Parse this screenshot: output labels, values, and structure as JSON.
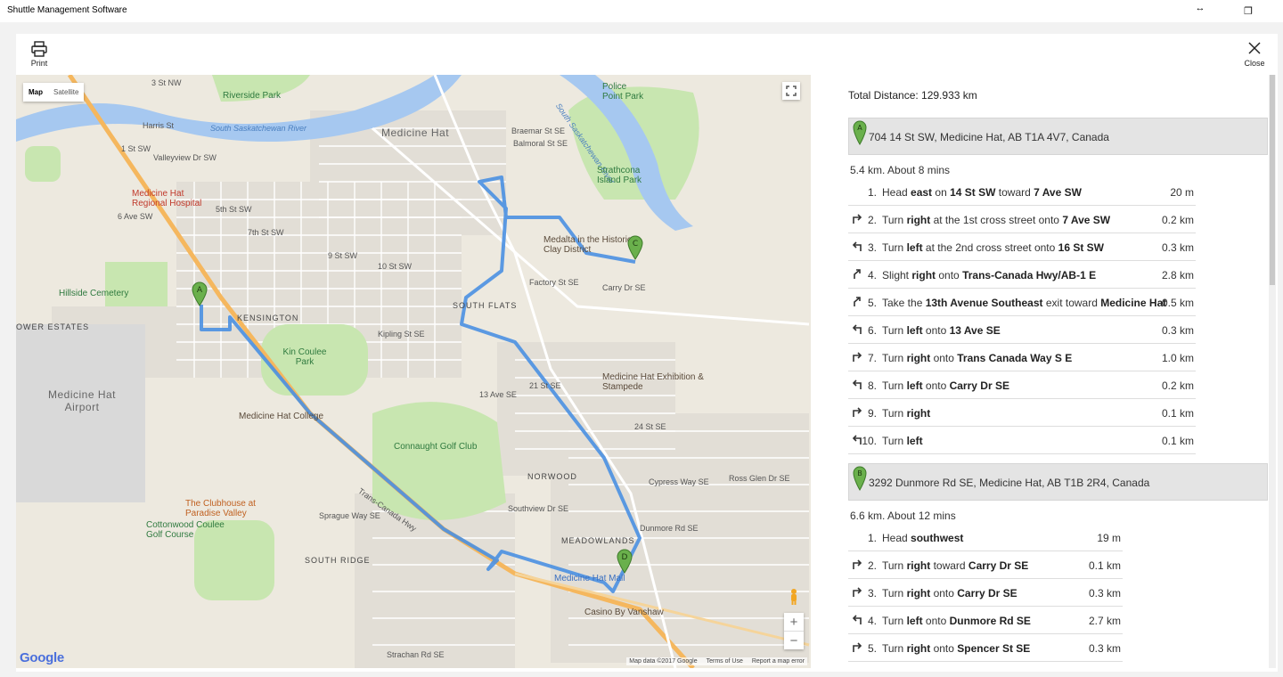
{
  "window": {
    "title": "Shuttle Management Software",
    "minimize_glyph": "↔",
    "restore_glyph": "❐"
  },
  "toolbar": {
    "print_label": "Print",
    "close_label": "Close"
  },
  "map": {
    "type_active": "Map",
    "type_other": "Satellite",
    "zoom_in": "+",
    "zoom_out": "−",
    "logo": "Google",
    "attribution": [
      "Map data ©2017 Google",
      "Terms of Use",
      "Report a map error"
    ],
    "markers": [
      "A",
      "B",
      "C",
      "D"
    ],
    "labels": {
      "medicine_hat": "Medicine Hat",
      "riverside_park": "Riverside Park",
      "river": "South Saskatchewan River",
      "river2": "South Saskatchewan River",
      "police_point": "Police Point Park",
      "strathcona": "Strathcona Island Park",
      "hospital": "Medicine Hat Regional Hospital",
      "medalta": "Medalta in the Historic Clay District",
      "hillside": "Hillside Cemetery",
      "kensington": "KENSINGTON",
      "south_flats": "SOUTH FLATS",
      "estates": "OWER ESTATES",
      "airport": "Medicine Hat Airport",
      "kin_coulee": "Kin Coulee Park",
      "exhibition": "Medicine Hat Exhibition & Stampede",
      "college": "Medicine Hat College",
      "connaught": "Connaught Golf Club",
      "norwood": "NORWOOD",
      "meadowlands": "MEADOWLANDS",
      "clubhouse": "The Clubhouse at Paradise Valley",
      "cottonwood": "Cottonwood Coulee Golf Course",
      "south_ridge": "SOUTH RIDGE",
      "mall": "Medicine Hat Mall",
      "casino": "Casino By Vanshaw",
      "trans_canada": "Trans-Canada Hwy",
      "st_3nw": "3 St NW",
      "st_1sw": "1 St SW",
      "harris": "Harris St",
      "valleyview": "Valleyview Dr SW",
      "ave_6sw": "6 Ave SW",
      "fifth_sw": "5th St SW",
      "seventh_sw": "7th St SW",
      "ninth_sw": "9 St SW",
      "ten_sw": "10 St SW",
      "carry": "Carry Dr SE",
      "factory": "Factory St SE",
      "kipling": "Kipling St SE",
      "braemar": "Braemar St SE",
      "balmoral": "Balmoral St SE",
      "cypress": "Cypress Way SE",
      "southview": "Southview Dr SE",
      "sprague": "Sprague Way SE",
      "strachan": "Strachan Rd SE",
      "ross_glen": "Ross Glen Dr SE",
      "dunmore": "Dunmore Rd SE",
      "ave_13se": "13 Ave SE",
      "twentyfour": "24 St SE",
      "twentyone": "21 St SE"
    }
  },
  "directions": {
    "total_distance": "Total Distance: 129.933 km",
    "legs": [
      {
        "marker": "A",
        "address": "704 14 St SW, Medicine Hat, AB T1A 4V7, Canada",
        "summary": "5.4 km. About 8 mins",
        "steps": [
          {
            "num": "1.",
            "icon": "none",
            "pre": "Head ",
            "b1": "east",
            "mid": " on ",
            "b2": "14 St SW",
            "post": " toward ",
            "b3": "7 Ave SW",
            "dist": "20 m"
          },
          {
            "num": "2.",
            "icon": "turn-right-icon",
            "pre": "Turn ",
            "b1": "right",
            "mid": " at the 1st cross street onto ",
            "b2": "7 Ave SW",
            "post": "",
            "b3": "",
            "dist": "0.2 km"
          },
          {
            "num": "3.",
            "icon": "turn-left-icon",
            "pre": "Turn ",
            "b1": "left",
            "mid": " at the 2nd cross street onto ",
            "b2": "16 St SW",
            "post": "",
            "b3": "",
            "dist": "0.3 km"
          },
          {
            "num": "4.",
            "icon": "slight-right-icon",
            "pre": "Slight ",
            "b1": "right",
            "mid": " onto ",
            "b2": "Trans-Canada Hwy/AB-1 E",
            "post": "",
            "b3": "",
            "dist": "2.8 km"
          },
          {
            "num": "5.",
            "icon": "slight-right-icon",
            "pre": "Take the ",
            "b1": "13th Avenue Southeast",
            "mid": " exit toward ",
            "b2": "Medicine Hat",
            "post": "",
            "b3": "",
            "dist": "0.5 km"
          },
          {
            "num": "6.",
            "icon": "turn-left-icon",
            "pre": "Turn ",
            "b1": "left",
            "mid": " onto ",
            "b2": "13 Ave SE",
            "post": "",
            "b3": "",
            "dist": "0.3 km"
          },
          {
            "num": "7.",
            "icon": "turn-right-icon",
            "pre": "Turn ",
            "b1": "right",
            "mid": " onto ",
            "b2": "Trans Canada Way S E",
            "post": "",
            "b3": "",
            "dist": "1.0 km"
          },
          {
            "num": "8.",
            "icon": "turn-left-icon",
            "pre": "Turn ",
            "b1": "left",
            "mid": " onto ",
            "b2": "Carry Dr SE",
            "post": "",
            "b3": "",
            "dist": "0.2 km"
          },
          {
            "num": "9.",
            "icon": "turn-right-icon",
            "pre": "Turn ",
            "b1": "right",
            "mid": "",
            "b2": "",
            "post": "",
            "b3": "",
            "dist": "0.1 km"
          },
          {
            "num": "10.",
            "icon": "turn-left-icon",
            "pre": "Turn ",
            "b1": "left",
            "mid": "",
            "b2": "",
            "post": "",
            "b3": "",
            "dist": "0.1 km"
          }
        ]
      },
      {
        "marker": "B",
        "address": "3292 Dunmore Rd SE, Medicine Hat, AB T1B 2R4, Canada",
        "summary": "6.6 km. About 12 mins",
        "steps": [
          {
            "num": "1.",
            "icon": "none",
            "pre": "Head ",
            "b1": "southwest",
            "mid": "",
            "b2": "",
            "post": "",
            "b3": "",
            "dist": "19 m"
          },
          {
            "num": "2.",
            "icon": "turn-right-icon",
            "pre": "Turn ",
            "b1": "right",
            "mid": " toward ",
            "b2": "Carry Dr SE",
            "post": "",
            "b3": "",
            "dist": "0.1 km"
          },
          {
            "num": "3.",
            "icon": "turn-right-icon",
            "pre": "Turn ",
            "b1": "right",
            "mid": " onto ",
            "b2": "Carry Dr SE",
            "post": "",
            "b3": "",
            "dist": "0.3 km"
          },
          {
            "num": "4.",
            "icon": "turn-left-icon",
            "pre": "Turn ",
            "b1": "left",
            "mid": " onto ",
            "b2": "Dunmore Rd SE",
            "post": "",
            "b3": "",
            "dist": "2.7 km"
          },
          {
            "num": "5.",
            "icon": "turn-right-icon",
            "pre": "Turn ",
            "b1": "right",
            "mid": " onto ",
            "b2": "Spencer St SE",
            "post": "",
            "b3": "",
            "dist": "0.3 km"
          }
        ]
      }
    ]
  },
  "colors": {
    "route": "#4a90e2",
    "marker": "#6ab04c",
    "park": "#c8e6b0",
    "water": "#a6c8f0",
    "highway": "#f5b75e"
  }
}
